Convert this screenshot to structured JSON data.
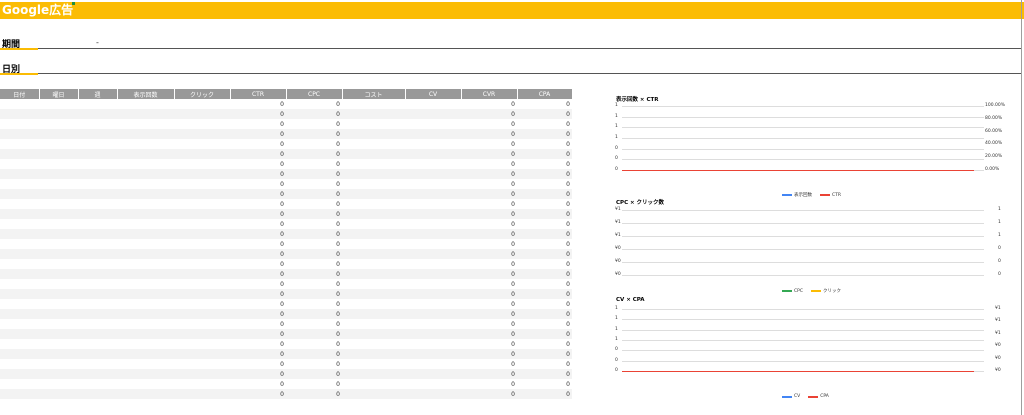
{
  "header": {
    "title": "Google広告"
  },
  "period": {
    "label": "期間",
    "separator": "-"
  },
  "daily": {
    "label": "日別"
  },
  "table": {
    "columns": [
      "日付",
      "曜日",
      "週",
      "表示回数",
      "クリック",
      "CTR",
      "CPC",
      "コスト",
      "CV",
      "CVR",
      "CPA"
    ],
    "row_value": "0",
    "row_count": 30
  },
  "charts": [
    {
      "title": "表示回数 × CTR",
      "left_ticks": [
        "1",
        "1",
        "1",
        "1",
        "0",
        "0",
        "0"
      ],
      "right_ticks": [
        "100.00%",
        "80.00%",
        "60.00%",
        "40.00%",
        "20.00%",
        "0.00%"
      ],
      "legend": [
        {
          "name": "表示回数",
          "color": "#4285f4"
        },
        {
          "name": "CTR",
          "color": "#ea4335"
        }
      ]
    },
    {
      "title": "CPC × クリック数",
      "left_ticks": [
        "¥1",
        "¥1",
        "¥1",
        "¥0",
        "¥0",
        "¥0"
      ],
      "right_ticks": [
        "1",
        "1",
        "1",
        "0",
        "0",
        "0"
      ],
      "legend": [
        {
          "name": "CPC",
          "color": "#34a853"
        },
        {
          "name": "クリック",
          "color": "#fbbc04"
        }
      ]
    },
    {
      "title": "CV × CPA",
      "left_ticks": [
        "1",
        "1",
        "1",
        "1",
        "0",
        "0",
        "0"
      ],
      "right_ticks": [
        "¥1",
        "¥1",
        "¥1",
        "¥0",
        "¥0",
        "¥0"
      ],
      "legend": [
        {
          "name": "CV",
          "color": "#4285f4"
        },
        {
          "name": "CPA",
          "color": "#ea4335"
        }
      ]
    }
  ]
}
